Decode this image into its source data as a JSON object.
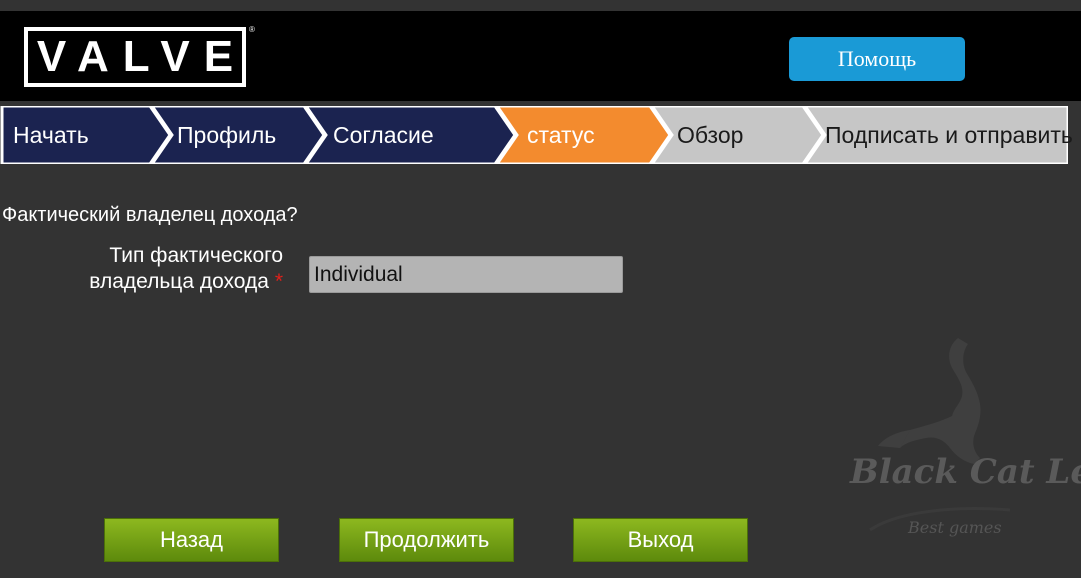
{
  "header": {
    "logo_text": "VALVE",
    "logo_tm": "®",
    "help_label": "Помощь"
  },
  "steps": [
    {
      "label": "Начать",
      "state": "done"
    },
    {
      "label": "Профиль",
      "state": "done"
    },
    {
      "label": "Согласие",
      "state": "done"
    },
    {
      "label": "статус",
      "state": "current"
    },
    {
      "label": "Обзор",
      "state": "pending"
    },
    {
      "label": "Подписать и отправить",
      "state": "pending"
    }
  ],
  "colors": {
    "done": "#1b2350",
    "current": "#f38b2e",
    "pending": "#c6c6c6",
    "help": "#1a9ad6",
    "nav_button": "#6f9e12"
  },
  "form": {
    "question": "Фактический владелец дохода?",
    "label_line1": "Тип фактического",
    "label_line2": "владельца дохода",
    "required_mark": "*",
    "value": "Individual"
  },
  "buttons": {
    "back": "Назад",
    "continue": "Продолжить",
    "exit": "Выход"
  },
  "watermark": {
    "text": "Black Cat Leo",
    "sub": "Best games"
  }
}
